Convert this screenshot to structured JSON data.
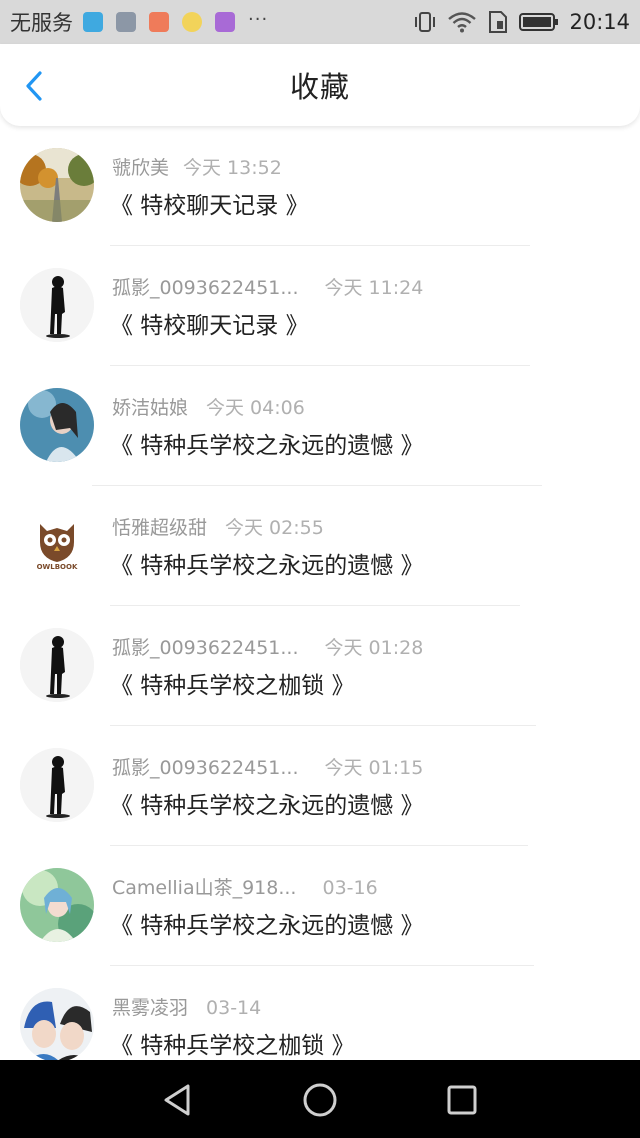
{
  "status_bar": {
    "carrier": "无服务",
    "more": "···",
    "time": "20:14"
  },
  "header": {
    "title": "收藏"
  },
  "favorites": [
    {
      "user": "虢欣美",
      "time": "今天 13:52",
      "book": "《 特校聊天记录 》",
      "avatar": "road-autumn"
    },
    {
      "user": "孤影_0093622451...",
      "time": "今天 11:24",
      "book": "《 特校聊天记录 》",
      "avatar": "silhouette"
    },
    {
      "user": "娇洁姑娘",
      "time": "今天 04:06",
      "book": "《 特种兵学校之永远的遗憾 》",
      "avatar": "girl-blue"
    },
    {
      "user": "恬雅超级甜",
      "time": "今天 02:55",
      "book": "《 特种兵学校之永远的遗憾 》",
      "avatar": "owlbook"
    },
    {
      "user": "孤影_0093622451...",
      "time": "今天 01:28",
      "book": "《 特种兵学校之枷锁 》",
      "avatar": "silhouette"
    },
    {
      "user": "孤影_0093622451...",
      "time": "今天 01:15",
      "book": "《 特种兵学校之永远的遗憾 》",
      "avatar": "silhouette"
    },
    {
      "user": "Camellia山茶_918...",
      "time": "03-16",
      "book": "《 特种兵学校之永远的遗憾 》",
      "avatar": "anime-green"
    },
    {
      "user": "黑雾凌羽",
      "time": "03-14",
      "book": "《 特种兵学校之枷锁 》",
      "avatar": "anime-duo"
    }
  ],
  "owlbook_logo_text": "OWLBOOK",
  "colors": {
    "accent": "#2196f3",
    "status_bar_bg": "#d9d9d9",
    "nav_bar_bg": "#000000"
  }
}
